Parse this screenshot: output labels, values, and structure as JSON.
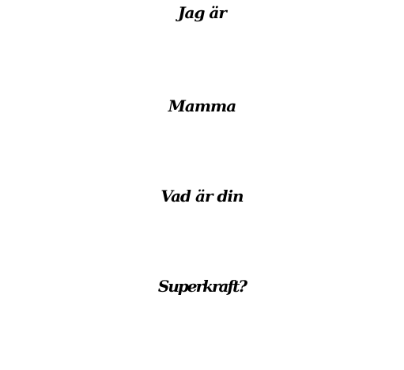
{
  "colors": {
    "background": "#ffffff",
    "text": "#000000"
  },
  "lines": [
    "Jag är",
    "Mamma",
    "Vad är din",
    "Superkraft?"
  ]
}
